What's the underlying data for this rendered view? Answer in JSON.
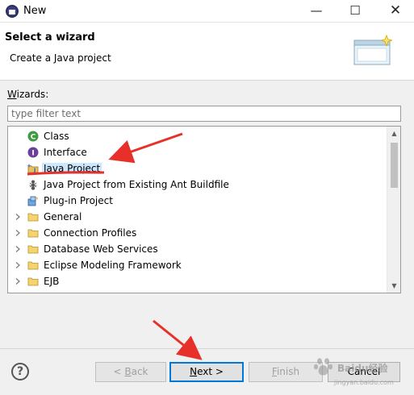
{
  "window": {
    "title": "New",
    "minimize": "—",
    "maximize": "☐",
    "close": "✕"
  },
  "header": {
    "title": "Select a wizard",
    "description": "Create a Java project"
  },
  "wizards_label": "Wizards:",
  "filter": {
    "placeholder": "type filter text",
    "value": ""
  },
  "tree": {
    "items": [
      {
        "label": "Class",
        "icon": "class-icon"
      },
      {
        "label": "Interface",
        "icon": "interface-icon"
      },
      {
        "label": "Java Project",
        "icon": "java-project-icon",
        "selected": true
      },
      {
        "label": "Java Project from Existing Ant Buildfile",
        "icon": "ant-icon"
      },
      {
        "label": "Plug-in Project",
        "icon": "plugin-icon"
      },
      {
        "label": "General",
        "icon": "folder-icon",
        "expandable": true
      },
      {
        "label": "Connection Profiles",
        "icon": "folder-icon",
        "expandable": true
      },
      {
        "label": "Database Web Services",
        "icon": "folder-icon",
        "expandable": true
      },
      {
        "label": "Eclipse Modeling Framework",
        "icon": "folder-icon",
        "expandable": true
      },
      {
        "label": "EJB",
        "icon": "folder-icon",
        "expandable": true
      }
    ]
  },
  "buttons": {
    "help": "?",
    "back": {
      "pre": "< ",
      "mnemonic": "B",
      "post": "ack"
    },
    "next": {
      "pre": "",
      "mnemonic": "N",
      "post": "ext >"
    },
    "finish": {
      "pre": "",
      "mnemonic": "F",
      "post": "inish"
    },
    "cancel": "Cancel"
  },
  "watermark": {
    "text": "Baidu经验",
    "sub": "jingyan.baidu.com"
  },
  "colors": {
    "selection": "#cce8ff",
    "annotation_red": "#e8302a",
    "default_button_border": "#0078d7"
  }
}
